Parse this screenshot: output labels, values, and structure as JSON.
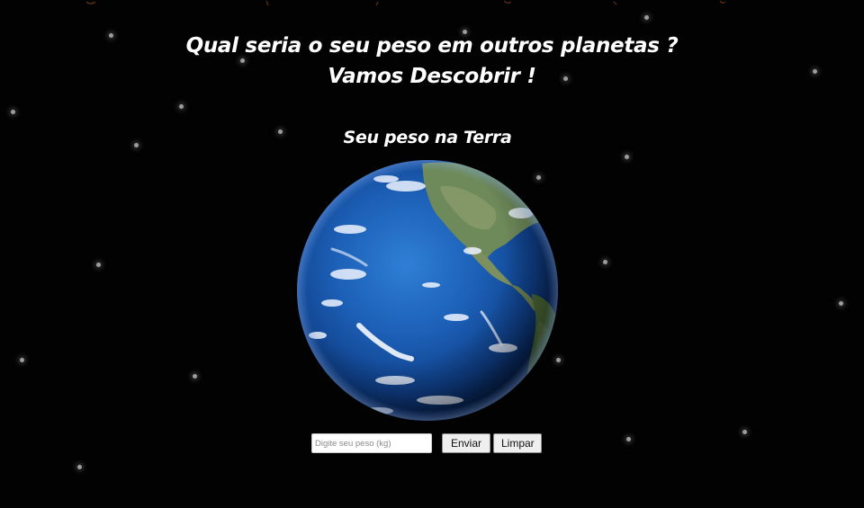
{
  "page": {
    "background": "#000000",
    "text_color": "#ffffff"
  },
  "header": {
    "line1": "Qual seria o seu peso em outros planetas ?",
    "line2": "Vamos Descobrir !"
  },
  "planet": {
    "label": "Seu peso na Terra",
    "image": "earth-globe"
  },
  "form": {
    "weight_placeholder": "Digite seu peso (kg)",
    "weight_value": "",
    "submit_label": "Enviar",
    "clear_label": "Limpar"
  }
}
